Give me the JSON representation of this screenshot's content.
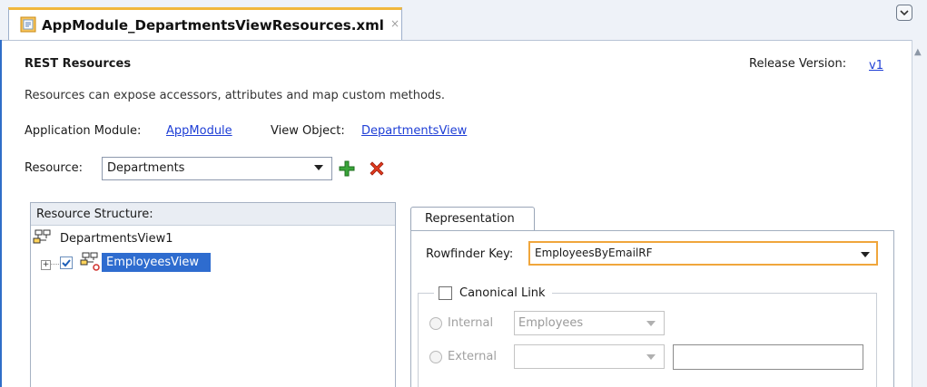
{
  "editor": {
    "tab_title": "AppModule_DepartmentsViewResources.xml",
    "tab_close": "×",
    "tab_icon": "xml-file-icon",
    "menu_icon": "chevron-down-icon"
  },
  "header": {
    "title": "REST Resources",
    "release_label": "Release Version:",
    "release_value": "v1",
    "description": "Resources can expose accessors, attributes and map custom methods."
  },
  "links": {
    "app_module_label": "Application Module:",
    "app_module_value": "AppModule",
    "view_object_label": "View Object:",
    "view_object_value": "DepartmentsView"
  },
  "resource": {
    "label": "Resource:",
    "selected": "Departments",
    "add_icon": "add-icon",
    "delete_icon": "delete-icon"
  },
  "structure": {
    "title": "Resource Structure:",
    "root": "DepartmentsView1",
    "child": "EmployeesView",
    "child_checked": true
  },
  "representation": {
    "tab_label": "Representation",
    "rowfinder_label": "Rowfinder Key:",
    "rowfinder_value": "EmployeesByEmailRF",
    "canonical_label": "Canonical Link",
    "internal_label": "Internal",
    "internal_value": "Employees",
    "external_label": "External",
    "external_value": ""
  },
  "colors": {
    "link": "#1f3fd6",
    "selection": "#2e6ccf",
    "focus": "#f0a63c"
  }
}
